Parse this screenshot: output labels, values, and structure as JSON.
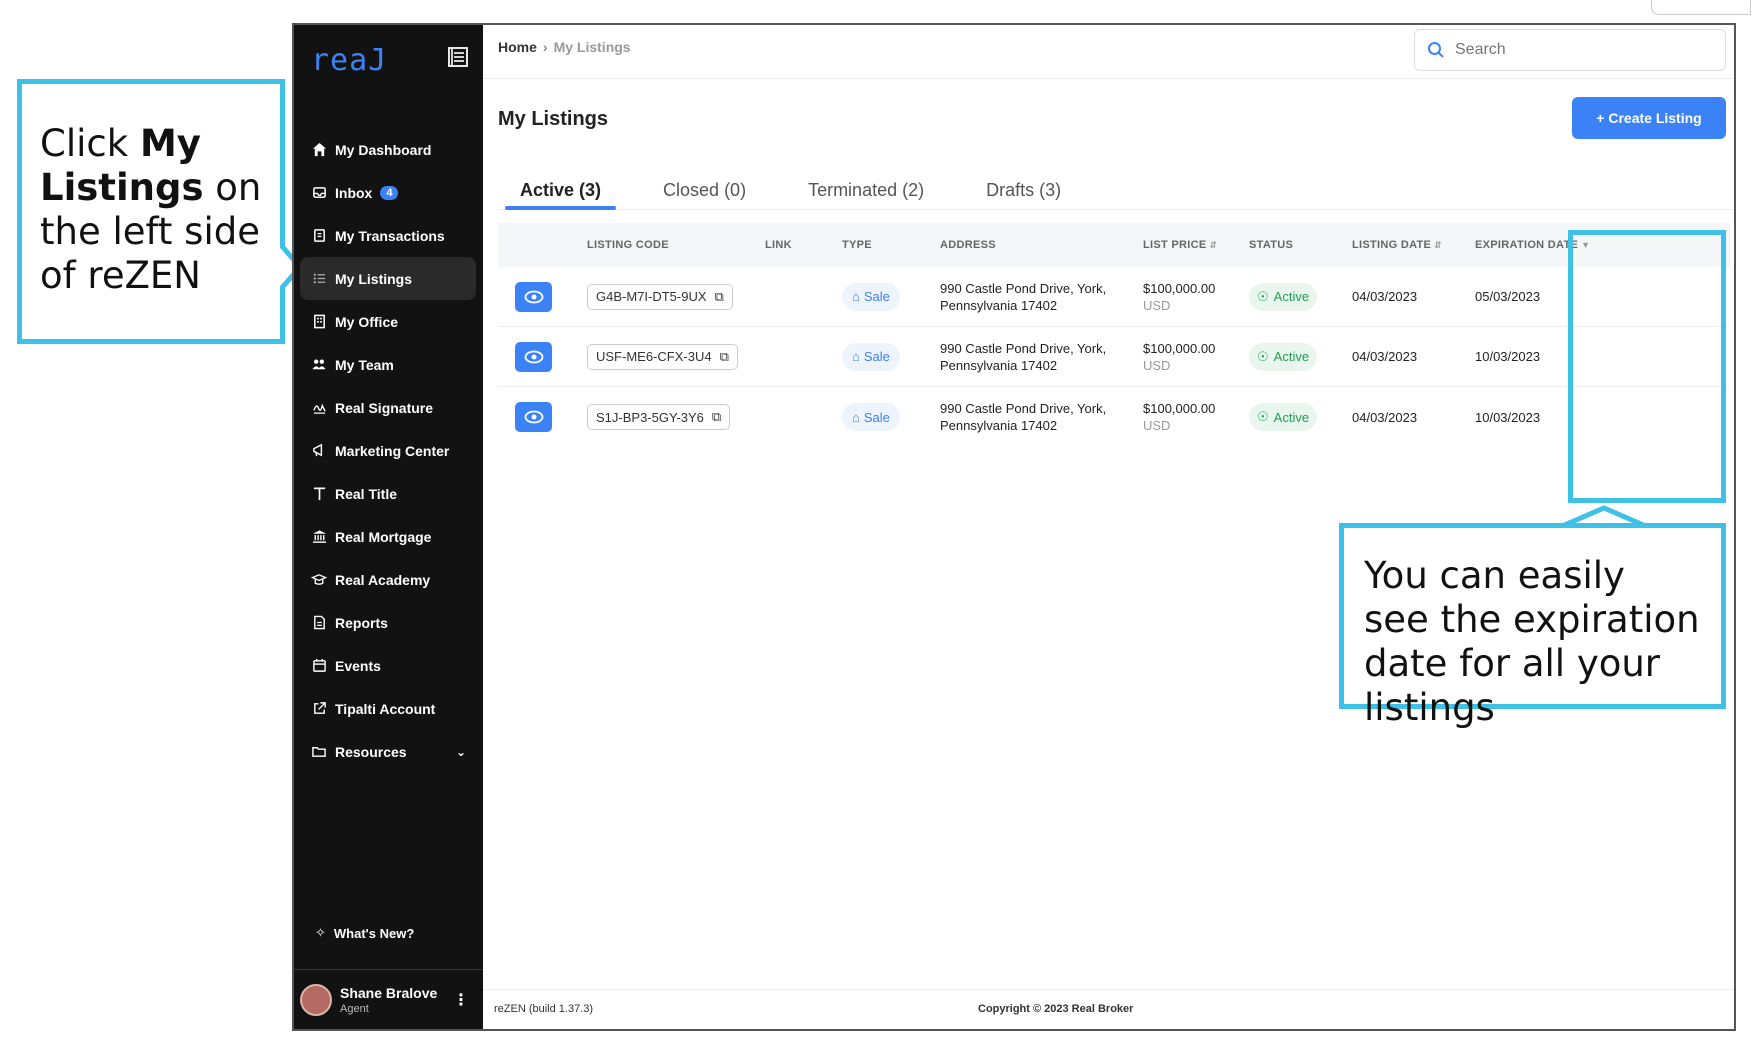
{
  "annotations": {
    "left_callout": {
      "pre": "Click ",
      "bold": "My Listings",
      "post": " on the left side of reZEN"
    },
    "right_callout": "You can easily see the expiration date for all your listings"
  },
  "sidebar": {
    "logo": "reaJ",
    "items": [
      {
        "label": "My Dashboard",
        "icon": "home-icon"
      },
      {
        "label": "Inbox",
        "icon": "inbox-icon",
        "badge": "4"
      },
      {
        "label": "My Transactions",
        "icon": "transactions-icon"
      },
      {
        "label": "My Listings",
        "icon": "list-icon",
        "active": true
      },
      {
        "label": "My Office",
        "icon": "office-icon"
      },
      {
        "label": "My Team",
        "icon": "team-icon"
      },
      {
        "label": "Real Signature",
        "icon": "signature-icon"
      },
      {
        "label": "Marketing Center",
        "icon": "megaphone-icon"
      },
      {
        "label": "Real Title",
        "icon": "title-t-icon"
      },
      {
        "label": "Real Mortgage",
        "icon": "bank-icon"
      },
      {
        "label": "Real Academy",
        "icon": "graduation-cap-icon"
      },
      {
        "label": "Reports",
        "icon": "report-icon"
      },
      {
        "label": "Events",
        "icon": "calendar-icon"
      },
      {
        "label": "Tipalti Account",
        "icon": "external-link-icon"
      },
      {
        "label": "Resources",
        "icon": "folder-icon"
      }
    ],
    "whats_new": "What's New?",
    "user": {
      "name": "Shane Bralove",
      "role": "Agent"
    }
  },
  "header": {
    "breadcrumb": {
      "home": "Home",
      "current": "My Listings"
    },
    "search_placeholder": "Search"
  },
  "page": {
    "title": "My Listings",
    "create_button": "+ Create Listing",
    "tabs": [
      "Active (3)",
      "Closed (0)",
      "Terminated (2)",
      "Drafts (3)"
    ]
  },
  "table": {
    "headers": [
      "",
      "LISTING CODE",
      "LINK",
      "TYPE",
      "ADDRESS",
      "LIST PRICE",
      "STATUS",
      "LISTING DATE",
      "EXPIRATION DATE"
    ],
    "rows": [
      {
        "code": "G4B-M7I-DT5-9UX",
        "type": "Sale",
        "address1": "990 Castle Pond Drive, York,",
        "address2": "Pennsylvania 17402",
        "price": "$100,000.00",
        "currency": "USD",
        "status": "Active",
        "listing_date": "04/03/2023",
        "expiration_date": "05/03/2023"
      },
      {
        "code": "USF-ME6-CFX-3U4",
        "type": "Sale",
        "address1": "990 Castle Pond Drive, York,",
        "address2": "Pennsylvania 17402",
        "price": "$100,000.00",
        "currency": "USD",
        "status": "Active",
        "listing_date": "04/03/2023",
        "expiration_date": "10/03/2023"
      },
      {
        "code": "S1J-BP3-5GY-3Y6",
        "type": "Sale",
        "address1": "990 Castle Pond Drive, York,",
        "address2": "Pennsylvania 17402",
        "price": "$100,000.00",
        "currency": "USD",
        "status": "Active",
        "listing_date": "04/03/2023",
        "expiration_date": "10/03/2023"
      }
    ]
  },
  "footer": {
    "build": "reZEN (build 1.37.3)",
    "copyright": "Copyright © 2023 Real Broker"
  },
  "colors": {
    "accent": "#3b82f6",
    "callout": "#3fc0e6",
    "sidebar_bg": "#121212",
    "status_green": "#1f9d55"
  }
}
